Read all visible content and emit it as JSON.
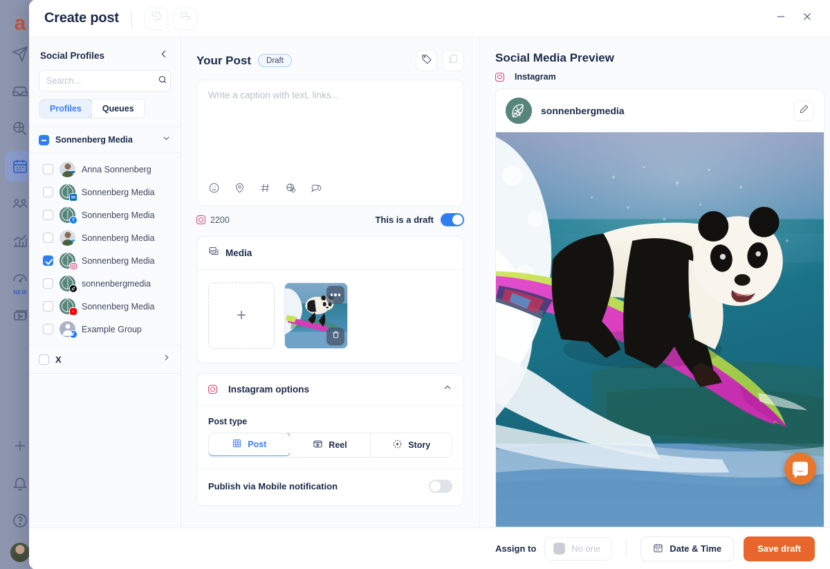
{
  "nav_rail": {
    "logo": "a",
    "items": [
      {
        "name": "publish-icon",
        "label": "Publish"
      },
      {
        "name": "inbox-icon",
        "label": "Inbox"
      },
      {
        "name": "monitor-icon",
        "label": "Monitoring"
      },
      {
        "name": "calendar-icon",
        "label": "Calendar",
        "active": true
      },
      {
        "name": "team-icon",
        "label": "Team"
      },
      {
        "name": "analytics-icon",
        "label": "Analytics"
      },
      {
        "name": "speedometer-icon",
        "label": "Insights",
        "badge": "NEW"
      },
      {
        "name": "video-icon",
        "label": "Video"
      }
    ],
    "bottom_items": [
      {
        "name": "add-icon",
        "label": "Add"
      },
      {
        "name": "bell-icon",
        "label": "Notifications"
      },
      {
        "name": "help-icon",
        "label": "Help"
      }
    ]
  },
  "titlebar": {
    "title": "Create post",
    "history_icon": "history-icon",
    "comments_icon": "comments-icon",
    "minimize_icon": "minimize-icon",
    "close_icon": "close-icon"
  },
  "profiles_panel": {
    "heading": "Social Profiles",
    "collapse_icon": "chevron-left-icon",
    "search": {
      "value": "",
      "placeholder": "Search...",
      "icon": "search-icon"
    },
    "tabs": [
      {
        "label": "Profiles",
        "selected": true
      },
      {
        "label": "Queues",
        "selected": false
      }
    ],
    "group": {
      "name": "Sonnenberg Media",
      "checkbox_state": "indeterminate",
      "chevron": "chevron-down-icon"
    },
    "profiles": [
      {
        "name": "Anna Sonnenberg",
        "network": "linkedin",
        "avatar": "person",
        "checked": false
      },
      {
        "name": "Sonnenberg Media",
        "network": "linkedin",
        "avatar": "leaf",
        "checked": false
      },
      {
        "name": "Sonnenberg Media",
        "network": "facebook",
        "avatar": "leaf",
        "checked": false
      },
      {
        "name": "Sonnenberg Media",
        "network": "twitter",
        "avatar": "person",
        "checked": false
      },
      {
        "name": "Sonnenberg Media",
        "network": "instagram",
        "avatar": "leaf",
        "checked": true
      },
      {
        "name": "sonnenbergmedia",
        "network": "tiktok",
        "avatar": "leaf",
        "checked": false
      },
      {
        "name": "Sonnenberg Media",
        "network": "youtube",
        "avatar": "leaf",
        "checked": false
      },
      {
        "name": "Example Group",
        "network": "facebook",
        "avatar": "grey",
        "checked": false
      }
    ],
    "x_group": {
      "label": "X",
      "checked": false,
      "chevron": "chevron-right-icon"
    }
  },
  "editor": {
    "heading": "Your Post",
    "status_pill": "Draft",
    "tag_icon": "tag-icon",
    "template_icon": "template-icon",
    "composer": {
      "value": "",
      "placeholder": "Write a caption with text, links...",
      "tools": [
        {
          "name": "emoji-icon"
        },
        {
          "name": "location-pin-icon"
        },
        {
          "name": "hashtag-icon"
        },
        {
          "name": "globe-icon"
        },
        {
          "name": "comment-icon"
        }
      ]
    },
    "char_count": "2200",
    "char_count_network": "instagram",
    "draft_toggle": {
      "label": "This is a draft",
      "on": true
    },
    "media_card": {
      "title": "Media",
      "icon": "media-icon",
      "add_button_glyph": "+",
      "thumbnails": [
        {
          "alt": "panda-surfing",
          "menu_icon": "more-dots-icon",
          "delete_icon": "trash-icon"
        }
      ]
    },
    "instagram_card": {
      "title": "Instagram options",
      "icon": "instagram-icon",
      "collapse_icon": "chevron-up-icon",
      "post_type_label": "Post type",
      "post_types": [
        {
          "label": "Post",
          "icon": "grid-icon",
          "selected": true
        },
        {
          "label": "Reel",
          "icon": "reel-icon",
          "selected": false
        },
        {
          "label": "Story",
          "icon": "story-icon",
          "selected": false
        }
      ],
      "publish_mobile": {
        "label": "Publish via Mobile notification",
        "on": false
      }
    }
  },
  "preview": {
    "heading": "Social Media Preview",
    "network_label": "Instagram",
    "network_icon": "instagram-icon",
    "account_name": "sonnenbergmedia",
    "edit_icon": "pencil-icon",
    "image_alt": "panda surfing on a pink and green surfboard over an ocean wave",
    "chat_widget": "intercom-chat-icon"
  },
  "footer": {
    "assign_label": "Assign to",
    "assignee": "No one",
    "date_time_button": {
      "label": "Date & Time",
      "icon": "calendar-icon"
    },
    "save_button": "Save draft"
  },
  "colors": {
    "accent_blue": "#2f7ff0",
    "brand_orange": "#e8662c",
    "title_navy": "#1b2a4a",
    "panel_bg": "#fafbfc",
    "avatar_teal": "#57857c"
  }
}
